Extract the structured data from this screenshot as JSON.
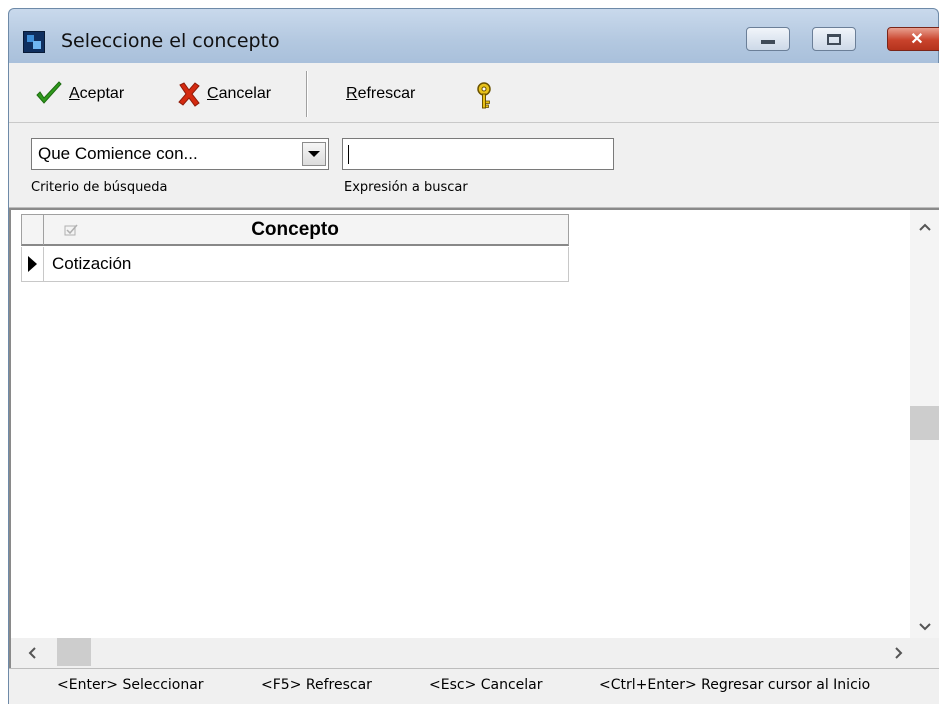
{
  "window": {
    "title": "Seleccione el concepto"
  },
  "toolbar": {
    "accept_label": "Aceptar",
    "cancel_label": "Cancelar",
    "refresh_label": "Refrescar"
  },
  "search": {
    "criteria_value": "Que Comience con...",
    "criteria_label": "Criterio de búsqueda",
    "expression_value": "",
    "expression_label": "Expresión a buscar"
  },
  "grid": {
    "column_header": "Concepto",
    "rows": [
      "Cotización"
    ]
  },
  "statusbar": {
    "hints": [
      "<Enter> Seleccionar",
      "<F5> Refrescar",
      "<Esc> Cancelar",
      "<Ctrl+Enter> Regresar cursor al Inicio"
    ]
  },
  "colors": {
    "accept_icon": "#2f9a1c",
    "cancel_icon": "#d42a10",
    "help_icon": "#e8c21a"
  },
  "icons": [
    "app-icon",
    "check-icon",
    "x-icon",
    "help-key-icon",
    "minimize-icon",
    "maximize-icon",
    "close-icon"
  ]
}
